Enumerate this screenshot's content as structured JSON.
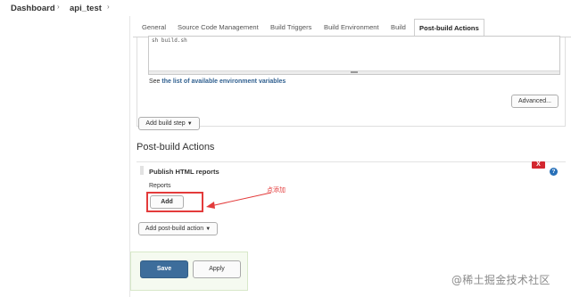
{
  "breadcrumb": {
    "items": [
      "Dashboard",
      "api_test"
    ],
    "separator": "›"
  },
  "tabs": [
    {
      "label": "General",
      "active": false
    },
    {
      "label": "Source Code Management",
      "active": false
    },
    {
      "label": "Build Triggers",
      "active": false
    },
    {
      "label": "Build Environment",
      "active": false
    },
    {
      "label": "Build",
      "active": false
    },
    {
      "label": "Post-build Actions",
      "active": true
    }
  ],
  "build": {
    "script_text": "sh build.sh",
    "see_prefix": "See",
    "see_link": "the list of available environment variables",
    "advanced_label": "Advanced...",
    "add_build_step_label": "Add build step"
  },
  "post_build": {
    "section_title": "Post-build Actions",
    "action_name": "Publish HTML reports",
    "close_label": "X",
    "help_label": "?",
    "reports_label": "Reports",
    "add_label": "Add",
    "add_post_build_label": "Add post-build action"
  },
  "annotation": {
    "text": "点添加",
    "color": "#e33b3b"
  },
  "footer": {
    "save_label": "Save",
    "apply_label": "Apply"
  },
  "watermark": "@稀土掘金技术社区",
  "colors": {
    "link": "#2f5f8f",
    "save_bg": "#3d6d9b",
    "close_bg": "#d3272f",
    "help_bg": "#2770b8"
  }
}
